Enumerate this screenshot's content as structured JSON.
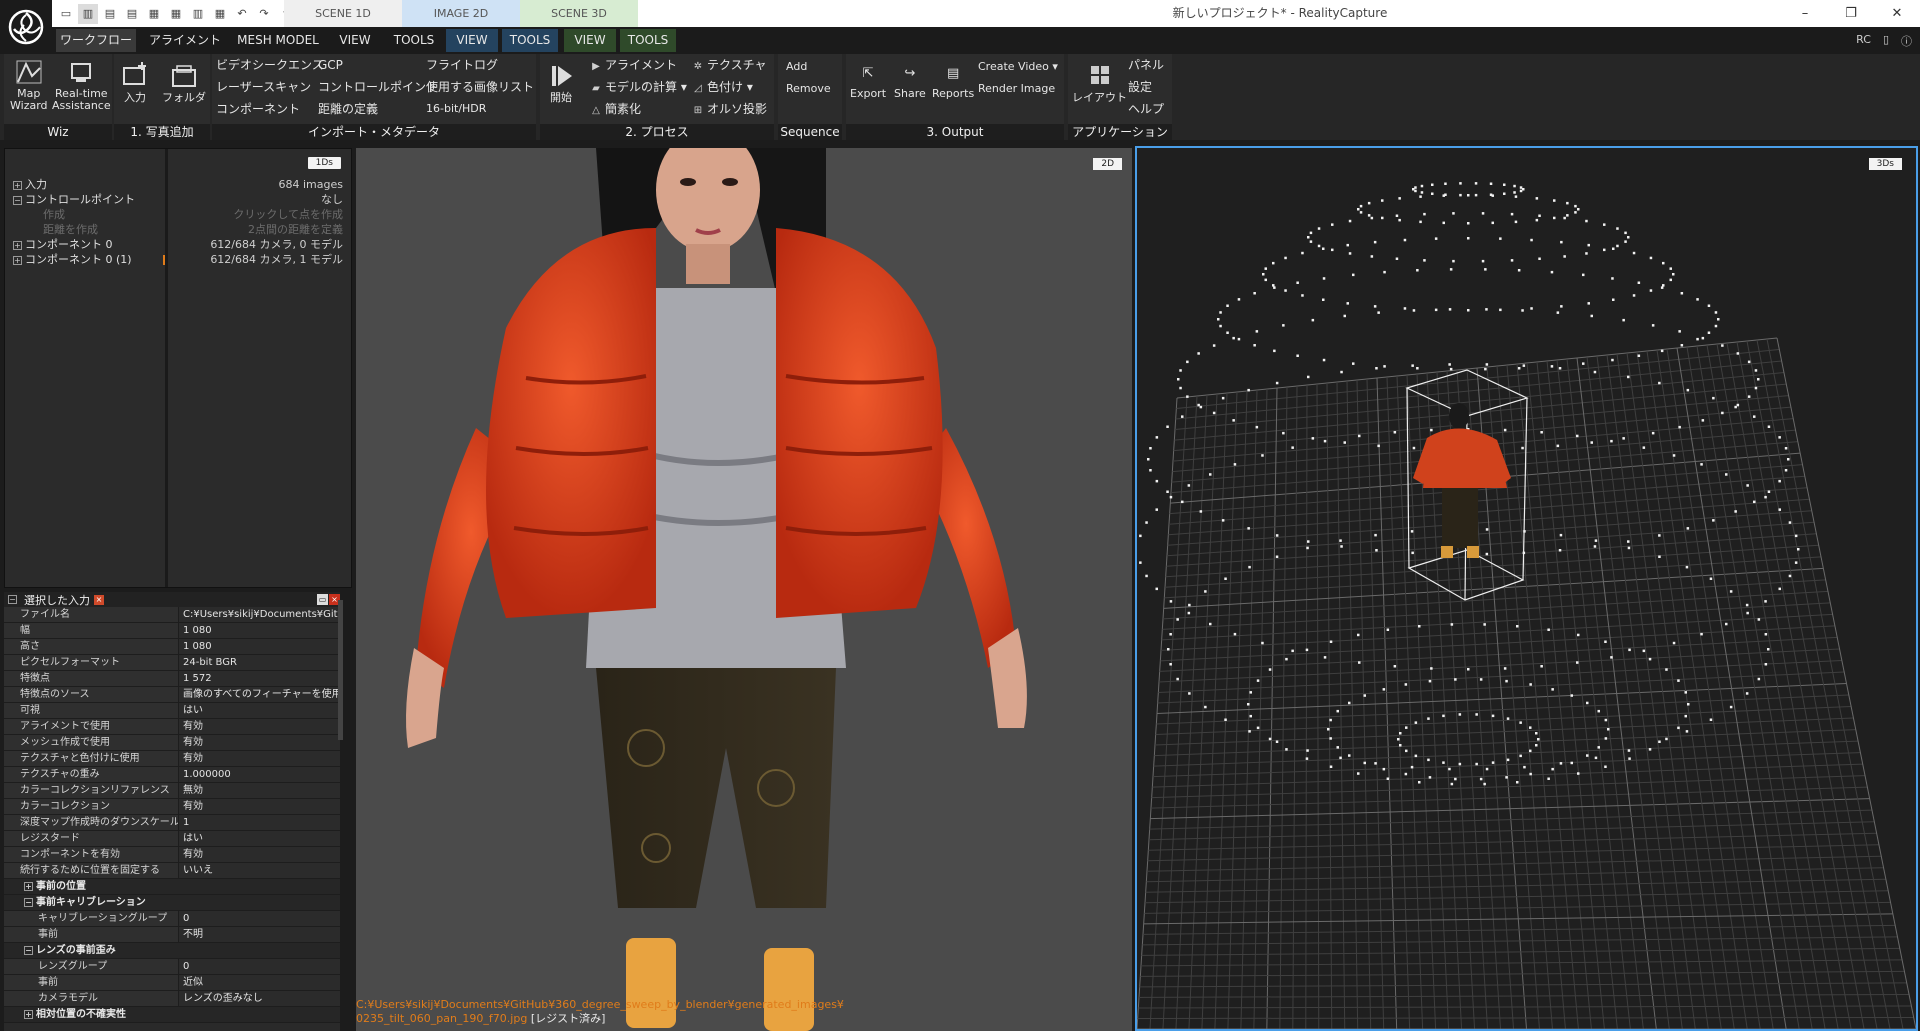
{
  "titlebar": {
    "window_title": "新しいプロジェクト* - RealityCapture",
    "context_tabs": [
      "SCENE 1D",
      "IMAGE 2D",
      "SCENE 3D"
    ],
    "qat_icons": [
      "layout-1-icon",
      "layout-2-icon",
      "layout-3-icon",
      "layout-4-icon",
      "layout-5-icon",
      "layout-6-icon",
      "layout-7-icon",
      "layout-8-icon",
      "undo-icon",
      "redo-icon",
      "customize-icon"
    ],
    "window_buttons": {
      "minimize": "–",
      "restore": "❐",
      "close": "✕"
    }
  },
  "ribbon_tabs": {
    "workflow": "ワークフロー",
    "alignment": "アライメント",
    "mesh_model": "MESH MODEL",
    "view1": "VIEW",
    "tools1": "TOOLS",
    "view2d": "VIEW",
    "tools2d": "TOOLS",
    "view3d": "VIEW",
    "tools3d": "TOOLS"
  },
  "corner": {
    "rc": "RC",
    "doc_icon": "document-icon",
    "help_icon": "help-icon"
  },
  "ribbon": {
    "wiz": {
      "label": "Wiz",
      "map_wizard": [
        "Map",
        "Wizard"
      ],
      "realtime": [
        "Real-time",
        "Assistance"
      ]
    },
    "photo_add": {
      "label": "1. 写真追加",
      "input": "入力",
      "folder": "フォルダ"
    },
    "import": {
      "label": "インポート・メタデータ",
      "col1": [
        "ビデオシークエンス",
        "レーザースキャン",
        "コンポーネント"
      ],
      "col2": [
        "GCP",
        "コントロールポイント",
        "距離の定義"
      ],
      "col3": [
        "フライトログ",
        "使用する画像リスト",
        "16-bit/HDR"
      ]
    },
    "process": {
      "label": "2. プロセス",
      "start": "開始",
      "col1": [
        "アライメント",
        "モデルの計算",
        "簡素化"
      ],
      "col2": [
        "テクスチャ",
        "色付け",
        "オルソ投影"
      ]
    },
    "sequence": {
      "label": "Sequence",
      "items": [
        "Add",
        "Remove"
      ]
    },
    "output": {
      "label": "3. Output",
      "export": "Export",
      "share": "Share",
      "reports": "Reports",
      "create_video": "Create Video",
      "render_image": "Render Image"
    },
    "application": {
      "label": "アプリケーション",
      "layout": "レイアウト",
      "items": [
        "パネル",
        "設定",
        "ヘルプ"
      ]
    }
  },
  "tree": {
    "badge": "1Ds",
    "rows": [
      {
        "label": "入力",
        "value": "684 images"
      },
      {
        "label": "コントロールポイント",
        "value": "なし"
      },
      {
        "label": "作成",
        "value": "クリックして点を作成"
      },
      {
        "label": "距離を作成",
        "value": "2点間の距離を定義"
      },
      {
        "label": "コンポーネント 0",
        "value": "612/684 カメラ, 0 モデル"
      },
      {
        "label": "コンポーネント 0 (1)",
        "value": "612/684 カメラ, 1 モデル"
      }
    ]
  },
  "props": {
    "title": "選択した入力",
    "rows": [
      {
        "k": "ファイル名",
        "v": "C:¥Users¥sikij¥Documents¥GitH..."
      },
      {
        "k": "幅",
        "v": "1 080"
      },
      {
        "k": "高さ",
        "v": "1 080"
      },
      {
        "k": "ピクセルフォーマット",
        "v": "24-bit BGR"
      },
      {
        "k": "特徴点",
        "v": "1 572"
      },
      {
        "k": "特徴点のソース",
        "v": "画像のすべてのフィーチャーを使用"
      },
      {
        "k": "可視",
        "v": "はい"
      },
      {
        "k": "アライメントで使用",
        "v": "有効"
      },
      {
        "k": "メッシュ作成で使用",
        "v": "有効"
      },
      {
        "k": "テクスチャと色付けに使用",
        "v": "有効"
      },
      {
        "k": "テクスチャの重み",
        "v": "1.000000"
      },
      {
        "k": "カラーコレクションリファレンス",
        "v": "無効"
      },
      {
        "k": "カラーコレクション",
        "v": "有効"
      },
      {
        "k": "深度マップ作成時のダウンスケール",
        "v": "1"
      },
      {
        "k": "レジスタード",
        "v": "はい"
      },
      {
        "k": "コンポーネントを有効",
        "v": "有効"
      },
      {
        "k": "続行するために位置を固定する",
        "v": "いいえ"
      }
    ],
    "sec_prior_pos": "事前の位置",
    "sec_prior_calib": "事前キャリブレーション",
    "calib_rows": [
      {
        "k": "キャリブレーショングループ",
        "v": "0"
      },
      {
        "k": "事前",
        "v": "不明"
      }
    ],
    "sec_lens": "レンズの事前歪み",
    "lens_rows": [
      {
        "k": "レンズグループ",
        "v": "0"
      },
      {
        "k": "事前",
        "v": "近似"
      },
      {
        "k": "カメラモデル",
        "v": "レンズの歪みなし"
      }
    ],
    "sec_relative": "相対位置の不確実性"
  },
  "viewport2d": {
    "badge": "2D",
    "path_line1": "C:¥Users¥sikij¥Documents¥GitHub¥360_degree_sweep_by_blender¥generated_images¥",
    "path_line2": "0235_tilt_060_pan_190_f70.jpg",
    "status": "[レジスト済み]"
  },
  "viewport3d": {
    "badge": "3Ds"
  },
  "colors": {
    "accent": "#4a9ee8",
    "jacket": "#e8461f",
    "path": "#e07c1a"
  }
}
